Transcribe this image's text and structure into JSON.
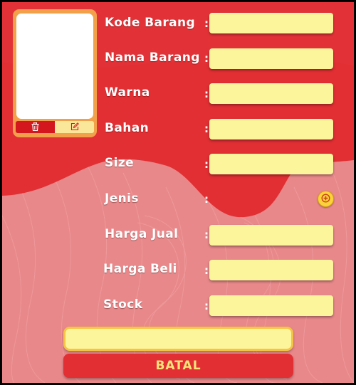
{
  "photo": {
    "delete_icon": "trash-icon",
    "edit_icon": "pencil-square-icon"
  },
  "form": {
    "fields": [
      {
        "label": "Kode Barang",
        "value": ""
      },
      {
        "label": "Nama Barang",
        "value": ""
      },
      {
        "label": "Warna",
        "value": ""
      },
      {
        "label": "Bahan",
        "value": ""
      },
      {
        "label": "Size",
        "value": ""
      },
      {
        "label": "Jenis",
        "value": ""
      },
      {
        "label": "Harga Jual",
        "value": ""
      },
      {
        "label": "Harga Beli",
        "value": ""
      },
      {
        "label": "Stock",
        "value": ""
      }
    ],
    "separator": ":",
    "jenis_add_icon": "plus-circle-icon"
  },
  "actions": {
    "save_label": "",
    "cancel_label": "BATAL"
  },
  "colors": {
    "header_red": "#e12f33",
    "background_pink": "#e8888a",
    "field_yellow": "#fdf59c",
    "frame_orange": "#f2a14a",
    "cancel_text": "#fbe47a"
  }
}
